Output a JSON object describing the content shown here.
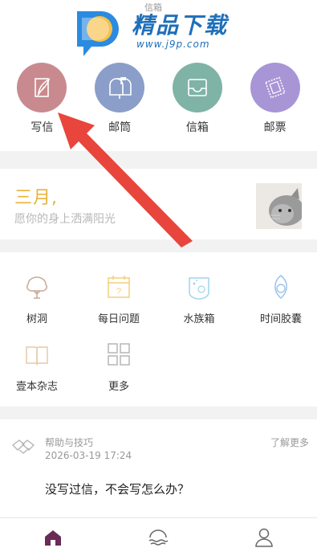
{
  "watermark": {
    "title": "精品下载",
    "url": "www.j9p.com"
  },
  "top_faint_text": "信箱",
  "quick_actions": [
    {
      "label": "写信",
      "icon": "quill-icon",
      "color": "#c98a8f"
    },
    {
      "label": "邮筒",
      "icon": "mailbox-icon",
      "color": "#8a9ec9"
    },
    {
      "label": "信箱",
      "icon": "inbox-tray-icon",
      "color": "#7fb3a6"
    },
    {
      "label": "邮票",
      "icon": "stamp-icon",
      "color": "#a895d6"
    }
  ],
  "month_card": {
    "title": "三月,",
    "subtitle": "愿你的身上洒满阳光"
  },
  "features": [
    {
      "label": "树洞",
      "icon": "tree-icon",
      "color": "#c9a99a"
    },
    {
      "label": "每日问题",
      "icon": "calendar-question-icon",
      "color": "#f2cf7a"
    },
    {
      "label": "水族箱",
      "icon": "fish-tank-icon",
      "color": "#9fd6ea"
    },
    {
      "label": "时间胶囊",
      "icon": "time-capsule-icon",
      "color": "#9fc4ea"
    },
    {
      "label": "壹本杂志",
      "icon": "open-book-icon",
      "color": "#e8c9a8"
    },
    {
      "label": "更多",
      "icon": "grid-more-icon",
      "color": "#b5b5b5"
    }
  ],
  "tips": {
    "title": "帮助与技巧",
    "date": "2026-03-19 17:24",
    "more_label": "了解更多",
    "question": "没写过信，不会写怎么办？"
  },
  "tabbar": [
    {
      "icon": "home-icon",
      "active": true,
      "color": "#6a2b57"
    },
    {
      "icon": "sea-wave-icon",
      "active": false,
      "color": "#666666"
    },
    {
      "icon": "profile-icon",
      "active": false,
      "color": "#666666"
    }
  ],
  "annotation_arrow_color": "#e8453c"
}
